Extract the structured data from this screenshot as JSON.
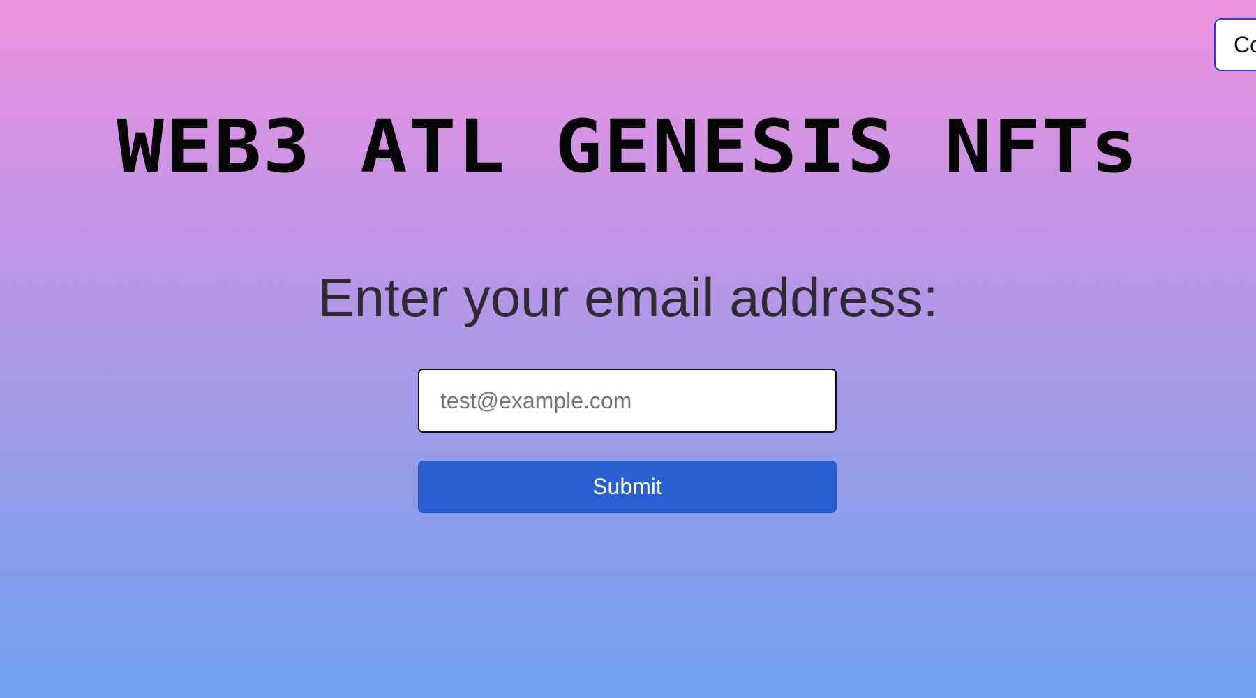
{
  "header": {
    "corner_button_label": "Co"
  },
  "main": {
    "title": "WEB3 ATL GENESIS NFTs",
    "prompt": "Enter your email address:",
    "email_input": {
      "value": "",
      "placeholder": "test@example.com"
    },
    "submit_label": "Submit"
  },
  "colors": {
    "gradient_top": "#ee91df",
    "gradient_bottom": "#6ea1ee",
    "submit_button": "#2a5fd1",
    "corner_button_border": "#2a3fd6"
  }
}
